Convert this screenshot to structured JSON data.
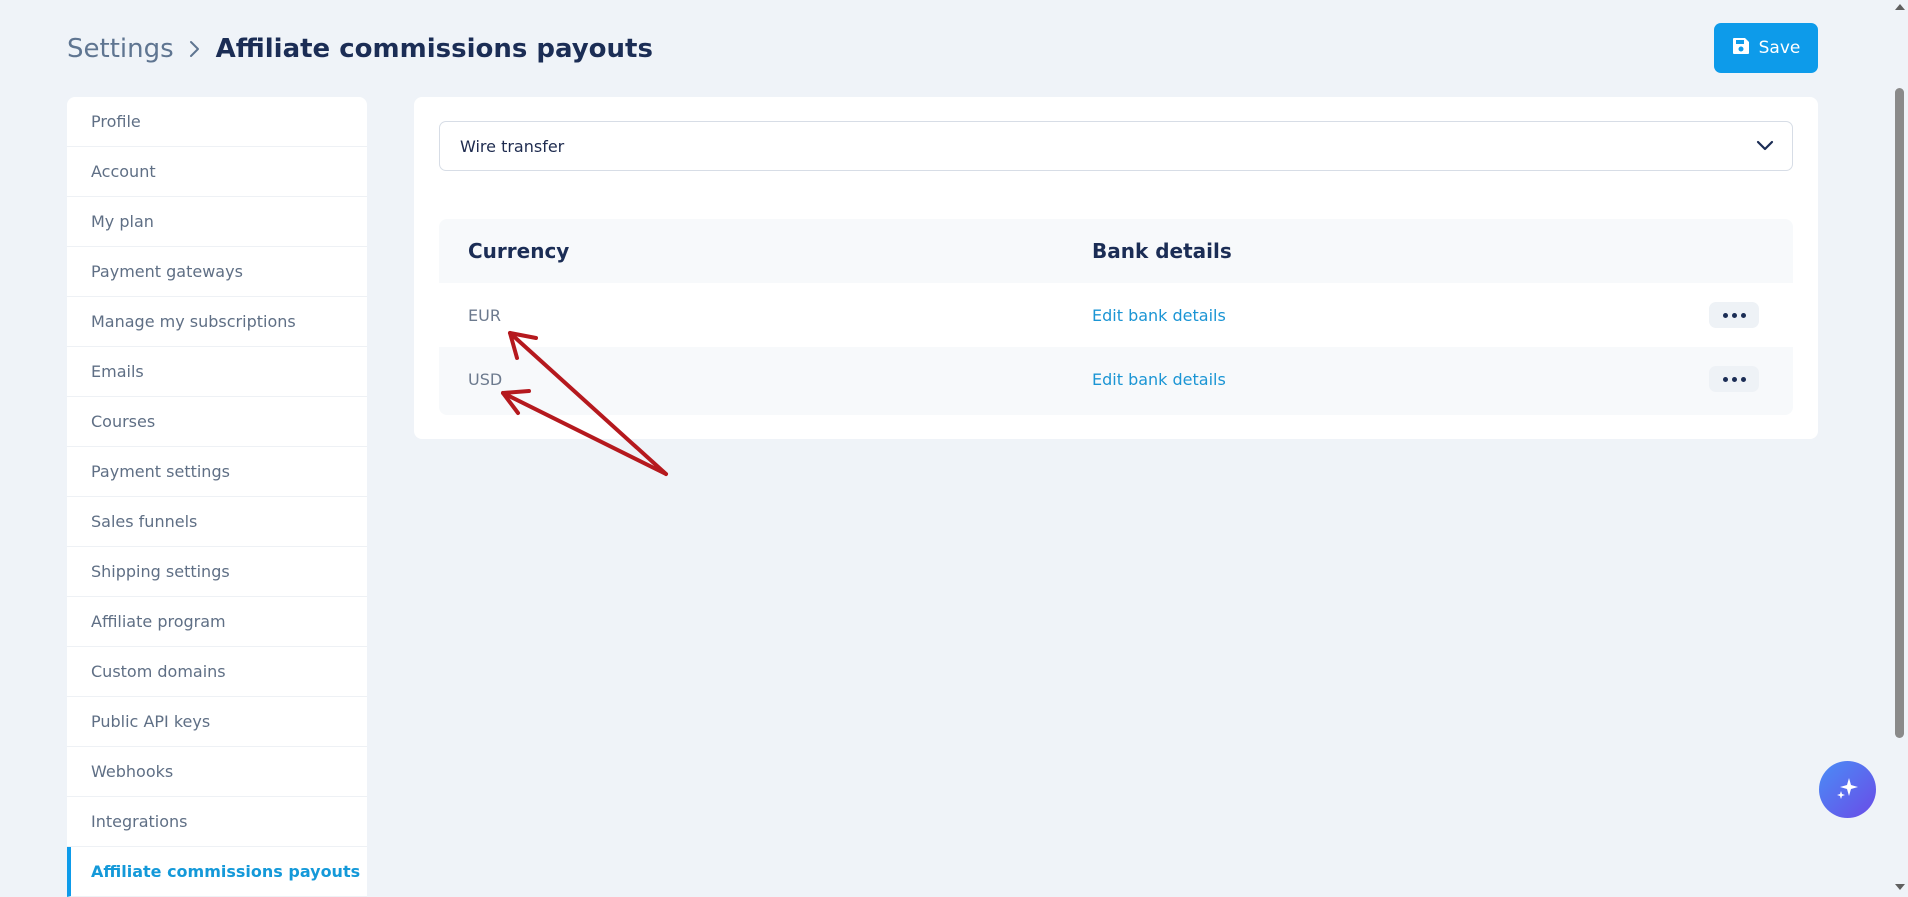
{
  "breadcrumb": {
    "root": "Settings",
    "current": "Affiliate commissions payouts"
  },
  "toolbar": {
    "save_label": "Save"
  },
  "sidebar": {
    "items": [
      {
        "label": "Profile"
      },
      {
        "label": "Account"
      },
      {
        "label": "My plan"
      },
      {
        "label": "Payment gateways"
      },
      {
        "label": "Manage my subscriptions"
      },
      {
        "label": "Emails"
      },
      {
        "label": "Courses"
      },
      {
        "label": "Payment settings"
      },
      {
        "label": "Sales funnels"
      },
      {
        "label": "Shipping settings"
      },
      {
        "label": "Affiliate program"
      },
      {
        "label": "Custom domains"
      },
      {
        "label": "Public API keys"
      },
      {
        "label": "Webhooks"
      },
      {
        "label": "Integrations"
      },
      {
        "label": "Affiliate commissions payouts",
        "active": true
      }
    ]
  },
  "payout_method": {
    "selected": "Wire transfer"
  },
  "table": {
    "headers": [
      "Currency",
      "Bank details"
    ],
    "rows": [
      {
        "currency": "EUR",
        "action": "Edit bank details"
      },
      {
        "currency": "USD",
        "action": "Edit bank details"
      }
    ]
  },
  "colors": {
    "accent": "#0d9bea",
    "annotation": "#b5191e"
  },
  "icons": {
    "save": "floppy-disk-icon",
    "breadcrumb_separator": "chevron-right-icon",
    "select": "chevron-down-icon",
    "row_menu": "more-horizontal-icon",
    "assistant": "sparkles-icon"
  }
}
